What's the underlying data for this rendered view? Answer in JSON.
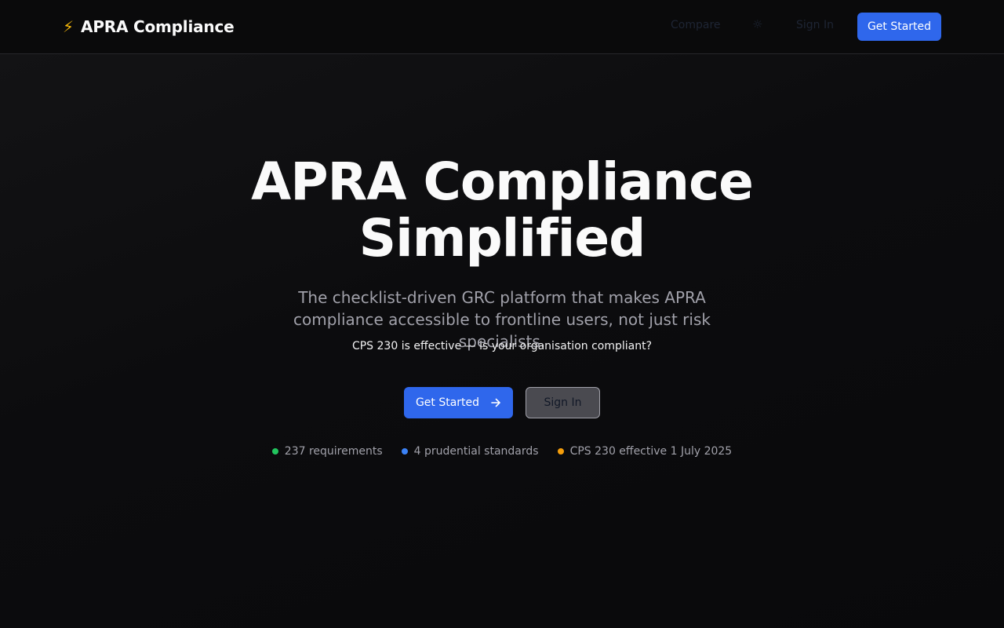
{
  "colors": {
    "accent": "#2f67ec",
    "background": "#09090b",
    "dot_green": "#22c55e",
    "dot_blue": "#3b82f6",
    "dot_orange": "#f59e0b"
  },
  "nav": {
    "brand_icon": "lightning-icon",
    "brand_glyph": "⚡",
    "brand_name": "APRA Compliance",
    "links": [
      {
        "label": "Compare"
      },
      {
        "label": "☼",
        "icon": "sun-icon"
      },
      {
        "label": "Sign In"
      }
    ],
    "cta_label": "Get Started"
  },
  "hero": {
    "title_line1": "APRA Compliance",
    "title_line2": "Simplified",
    "subtitle": "The checklist-driven GRC platform that makes APRA compliance accessible to frontline users, not just risk specialists.",
    "notice": "CPS 230 is effective — is your organisation compliant?",
    "primary_cta": "Get Started",
    "primary_cta_icon": "arrow-right-icon",
    "secondary_cta": "Sign In"
  },
  "stats": [
    {
      "label": "237 requirements",
      "color": "#22c55e"
    },
    {
      "label": "4 prudential standards",
      "color": "#3b82f6"
    },
    {
      "label": "CPS 230 effective 1 July 2025",
      "color": "#f59e0b"
    }
  ]
}
